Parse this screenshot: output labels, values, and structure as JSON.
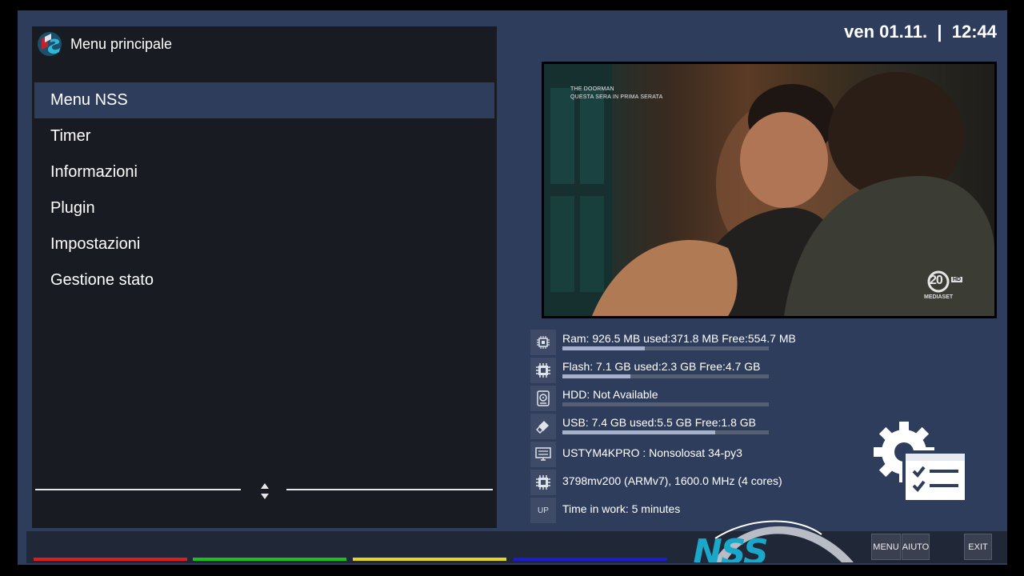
{
  "header": {
    "title": "Menu principale",
    "datetime": "ven 01.11.  |  12:44"
  },
  "menu": {
    "items": [
      {
        "label": "Menu NSS",
        "selected": true
      },
      {
        "label": "Timer",
        "selected": false
      },
      {
        "label": "Informazioni",
        "selected": false
      },
      {
        "label": "Plugin",
        "selected": false
      },
      {
        "label": "Impostazioni",
        "selected": false
      },
      {
        "label": "Gestione stato",
        "selected": false
      }
    ]
  },
  "preview": {
    "program_line1": "THE DOORMAN",
    "program_line2": "QUESTA SERA IN PRIMA SERATA",
    "channel_logo_number": "20",
    "channel_logo_hd": "HD",
    "channel_logo_brand": "MEDIASET"
  },
  "info": {
    "rows": [
      {
        "icon": "memory-chip-icon",
        "text": "Ram: 926.5 MB used:371.8 MB Free:554.7 MB",
        "usage": 0.401
      },
      {
        "icon": "flash-chip-icon",
        "text": "Flash: 7.1 GB used:2.3 GB Free:4.7 GB",
        "usage": 0.33
      },
      {
        "icon": "hdd-icon",
        "text": "HDD: Not Available",
        "usage": 0
      },
      {
        "icon": "usb-icon",
        "text": "USB: 7.4 GB used:5.5 GB Free:1.8 GB",
        "usage": 0.74
      },
      {
        "icon": "monitor-icon",
        "text": "USTYM4KPRO : Nonsolosat 34-py3"
      },
      {
        "icon": "cpu-icon",
        "text": "3798mv200 (ARMv7), 1600.0 MHz (4 cores)"
      },
      {
        "icon": "uptime-icon",
        "icon_text": "UP",
        "text": "Time in work: 5 minutes"
      }
    ]
  },
  "footer": {
    "buttons": {
      "menu": "MENU",
      "help": "AIUTO",
      "exit": "EXIT"
    },
    "logo_text": "NSS",
    "color_keys": [
      "#e01b1b",
      "#19c219",
      "#e5d51b",
      "#1b1bd6"
    ]
  },
  "colors": {
    "panel": "#181b21",
    "background": "#2f3d5d",
    "selection": "#2f3d5d"
  }
}
